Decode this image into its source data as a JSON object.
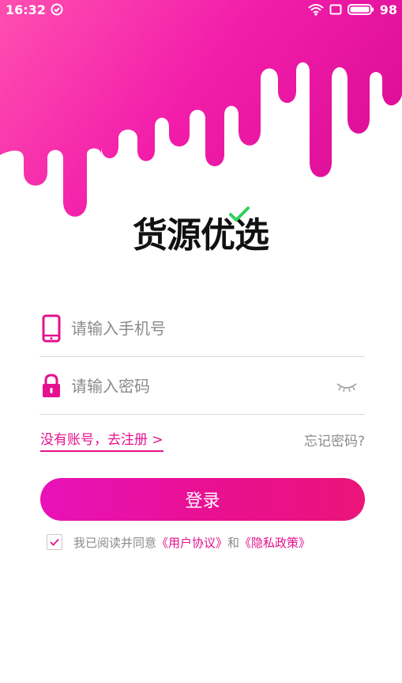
{
  "status_bar": {
    "time": "16:32",
    "battery": "98"
  },
  "brand": {
    "logo_text": "货源优选",
    "accent": "#e5118e",
    "accent_gradient_start": "#e812b9",
    "logo_check_color": "#2fd15a"
  },
  "login_form": {
    "phone_placeholder": "请输入手机号",
    "password_placeholder": "请输入密码",
    "register_link": "没有账号，去注册 >",
    "forgot_link": "忘记密码?",
    "login_button": "登录"
  },
  "agreement": {
    "prefix": "我已阅读并同意",
    "user_agreement": "《用户协议》",
    "and": "和",
    "privacy_policy": "《隐私政策》",
    "checked": true
  },
  "icons": {
    "phone": "phone-icon",
    "lock": "lock-icon",
    "eye": "eye-closed-icon",
    "wifi": "wifi-icon",
    "battery": "battery-icon",
    "alarm": "check-circle-icon",
    "screen": "screen-icon"
  }
}
